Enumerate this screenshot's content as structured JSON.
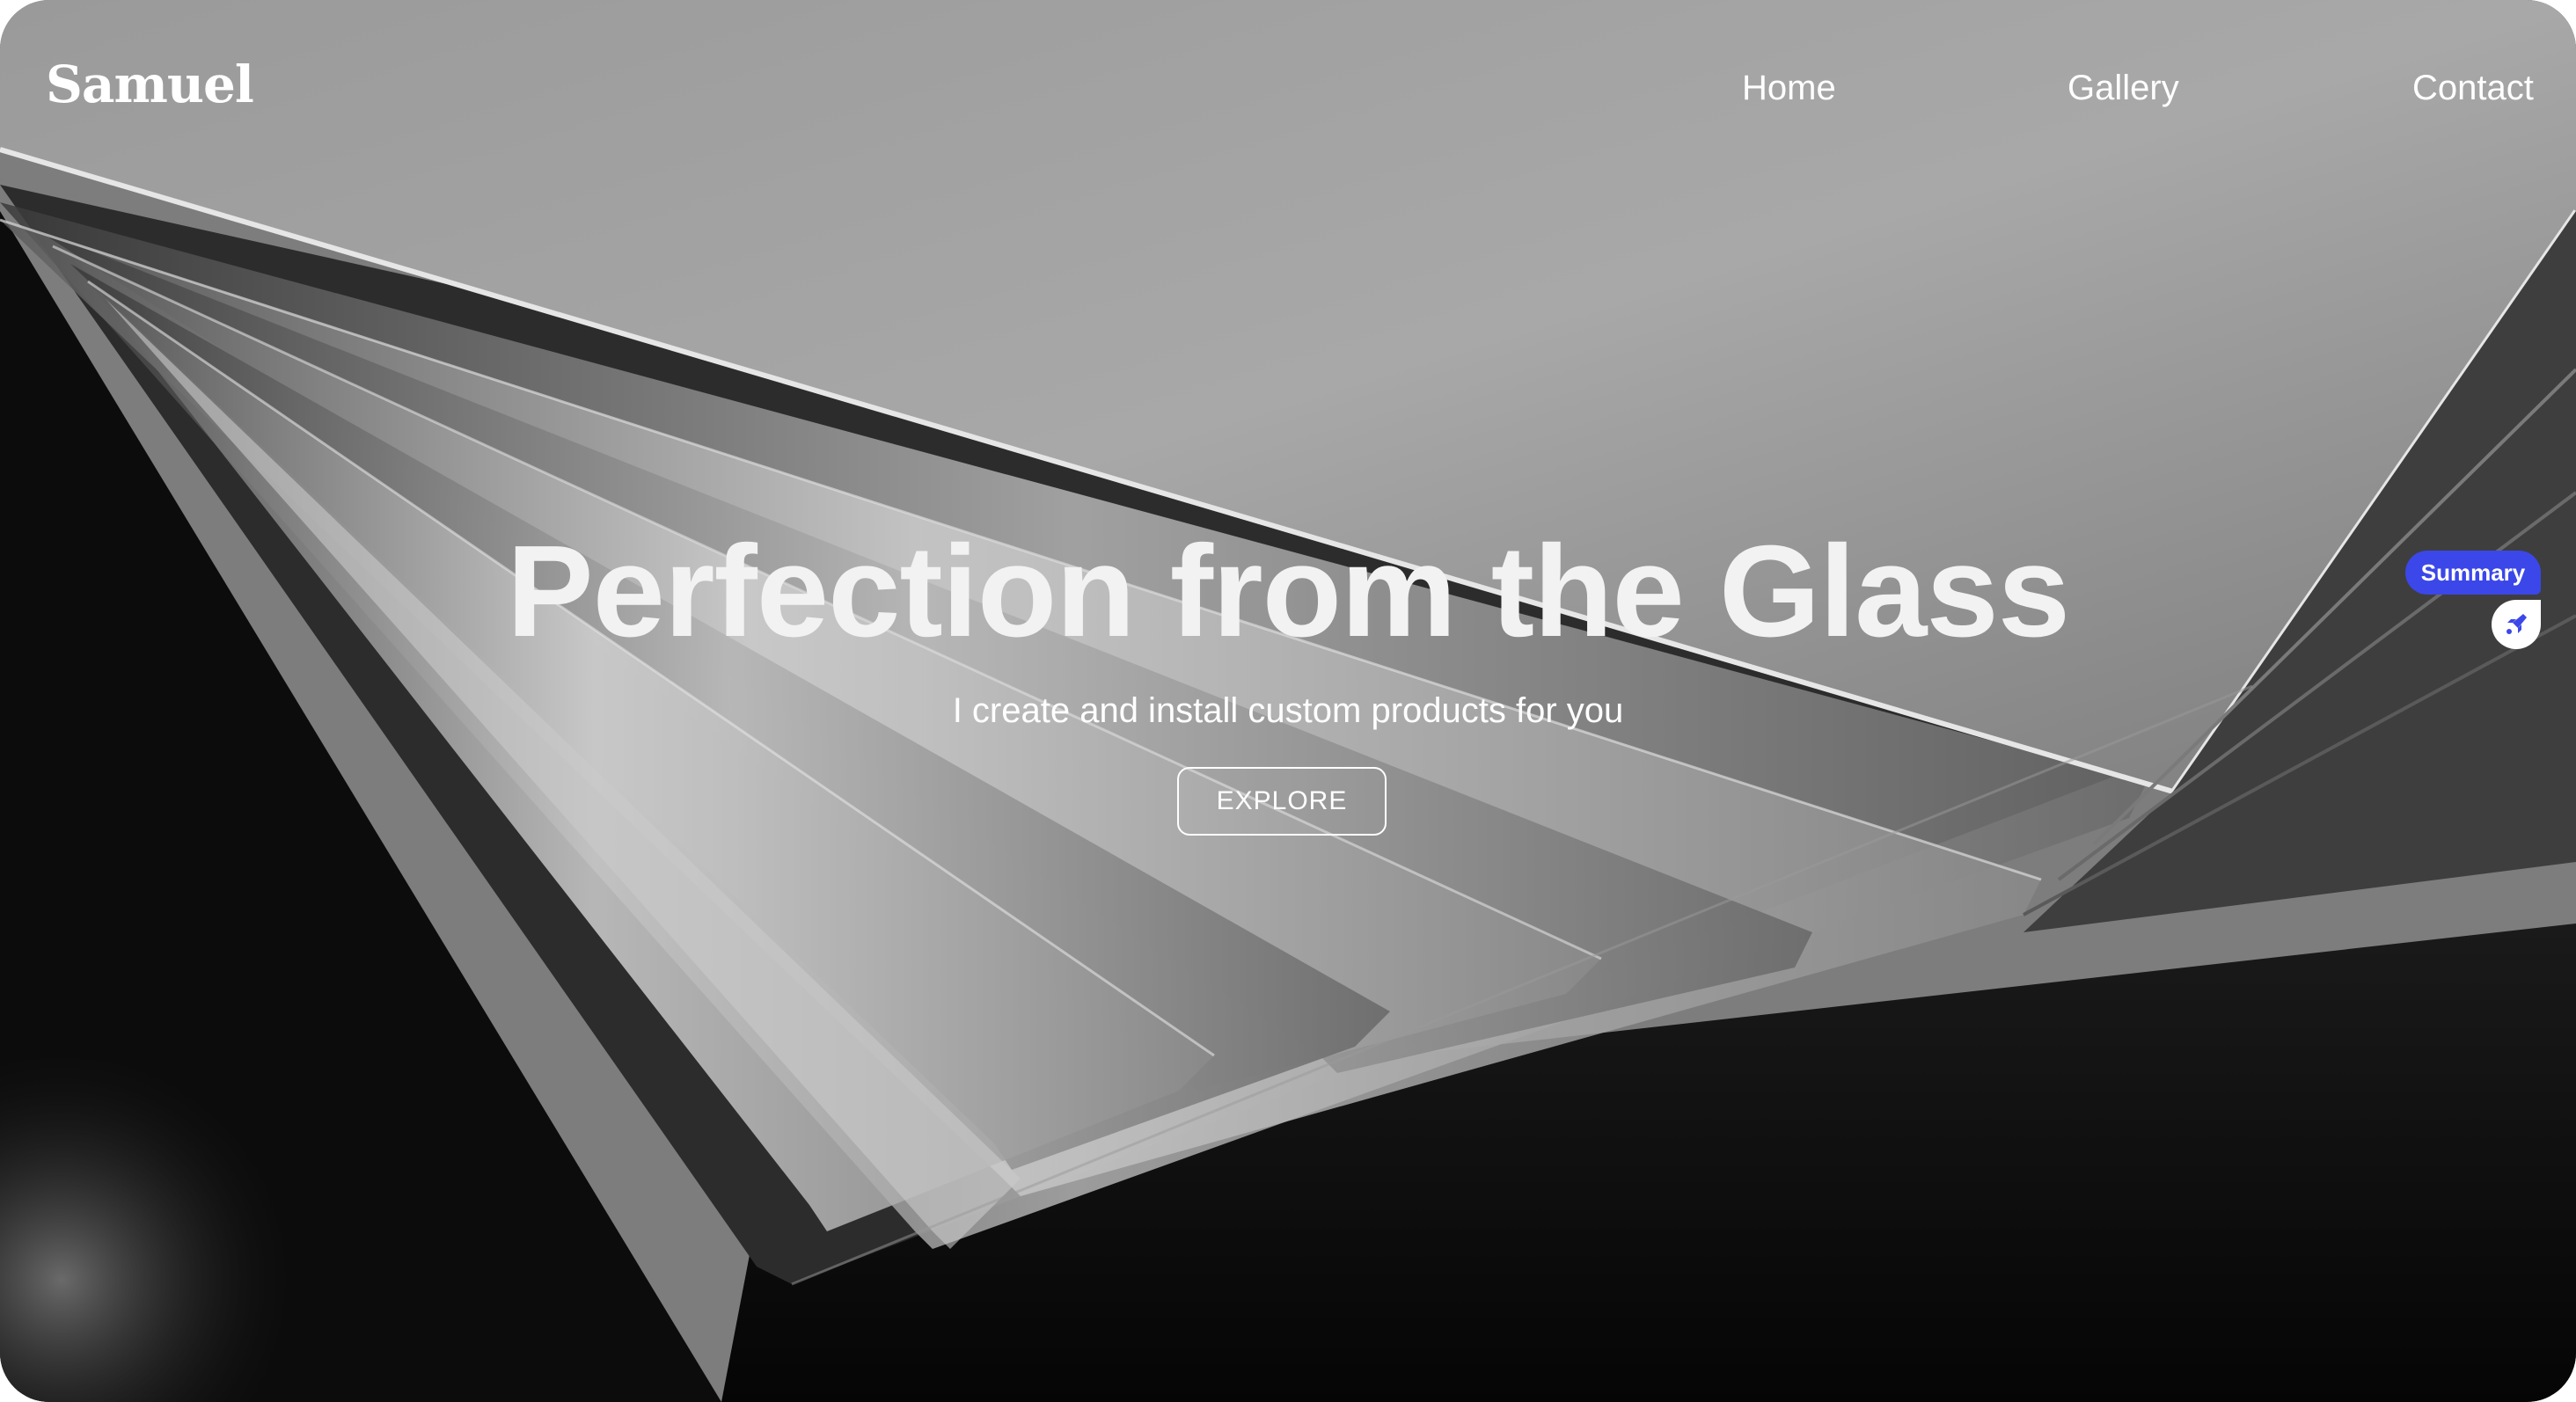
{
  "brand": {
    "name": "Samuel"
  },
  "nav": {
    "links": [
      {
        "label": "Home"
      },
      {
        "label": "Gallery"
      },
      {
        "label": "Contact"
      }
    ]
  },
  "hero": {
    "title": "Perfection from the Glass",
    "subtitle": "I create and install custom products for you",
    "cta_label": "EXPLORE"
  },
  "widget": {
    "summary_label": "Summary",
    "icon": "rocket-icon",
    "accent_color": "#3b47e8"
  },
  "icons": {
    "summary_widget_icon": "rocket-icon"
  }
}
